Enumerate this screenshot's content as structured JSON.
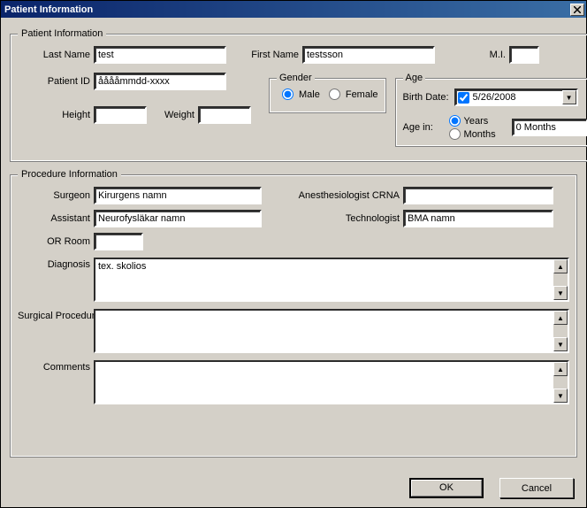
{
  "window": {
    "title": "Patient Information"
  },
  "patient": {
    "legend": "Patient Information",
    "last_name_label": "Last Name",
    "last_name": "test",
    "first_name_label": "First Name",
    "first_name": "testsson",
    "mi_label": "M.I.",
    "mi": "",
    "patient_id_label": "Patient ID",
    "patient_id": "ååååmmdd-xxxx",
    "height_label": "Height",
    "height": "",
    "weight_label": "Weight",
    "weight": "",
    "gender": {
      "legend": "Gender",
      "male_label": "Male",
      "female_label": "Female",
      "selected": "male"
    },
    "age": {
      "legend": "Age",
      "birth_date_label": "Birth Date:",
      "birth_date": "5/26/2008",
      "birth_date_checked": true,
      "age_in_label": "Age in:",
      "years_label": "Years",
      "months_label": "Months",
      "selected_unit": "years",
      "age_value": "0 Months"
    }
  },
  "procedure": {
    "legend": "Procedure Information",
    "surgeon_label": "Surgeon",
    "surgeon": "Kirurgens namn",
    "anesthesiologist_label": "Anesthesiologist CRNA",
    "anesthesiologist": "",
    "assistant_label": "Assistant",
    "assistant": "Neurofysläkar namn",
    "technologist_label": "Technologist",
    "technologist": "BMA namn",
    "or_room_label": "OR Room",
    "or_room": "",
    "diagnosis_label": "Diagnosis",
    "diagnosis": "tex. skolios",
    "surgical_procedure_label": "Surgical Procedure",
    "surgical_procedure": "",
    "comments_label": "Comments",
    "comments": ""
  },
  "buttons": {
    "ok": "OK",
    "cancel": "Cancel"
  }
}
